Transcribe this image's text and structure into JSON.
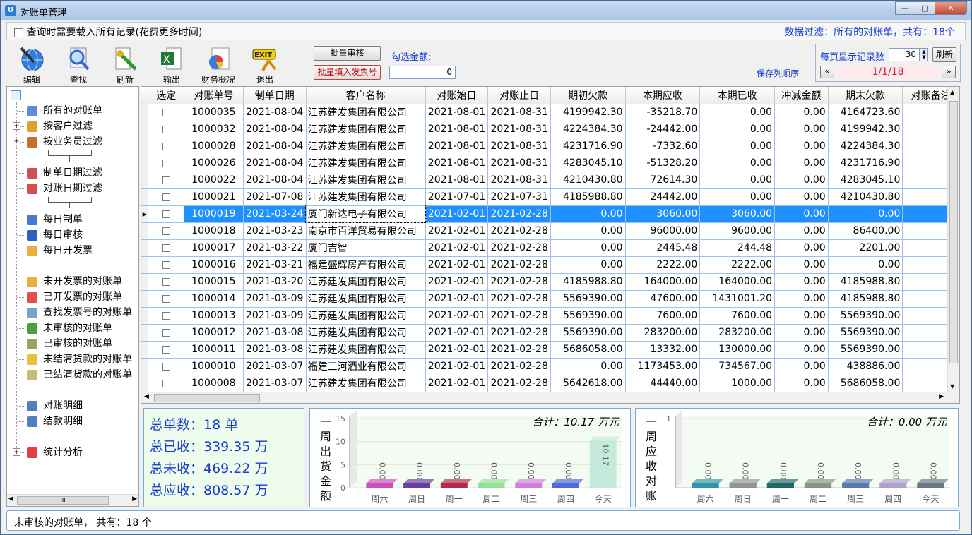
{
  "window": {
    "title": "对账单管理",
    "app_icon": "U"
  },
  "options": {
    "load_all_label": "查询时需要载入所有记录(花费更多时间)",
    "filter_info": "数据过滤：所有的对账单，共有：18个"
  },
  "toolbar": {
    "edit": "编辑",
    "find": "查找",
    "refresh": "刷新",
    "export": "输出",
    "finance": "财务概况",
    "exit": "退出",
    "exit_badge": "EXIT",
    "batch_audit": "批量审核",
    "batch_invoice": "批量填入发票号",
    "checked_amount_label": "勾选金额:",
    "checked_amount": "0",
    "save_order": "保存列顺序",
    "page_size_label": "每页显示记录数",
    "page_size": "30",
    "refresh_btn": "刷新",
    "page_indicator": "1/1/18",
    "prev": "«",
    "next": "»"
  },
  "tree": {
    "items": [
      {
        "label": "所有的对账单"
      },
      {
        "label": "按客户过滤"
      },
      {
        "label": "按业务员过滤"
      },
      {
        "label": "制单日期过滤"
      },
      {
        "label": "对账日期过滤"
      },
      {
        "label": "每日制单"
      },
      {
        "label": "每日审核"
      },
      {
        "label": "每日开发票"
      },
      {
        "label": "未开发票的对账单"
      },
      {
        "label": "已开发票的对账单"
      },
      {
        "label": "查找发票号的对账单"
      },
      {
        "label": "未审核的对账单"
      },
      {
        "label": "已审核的对账单"
      },
      {
        "label": "未结清货款的对账单"
      },
      {
        "label": "已结清货款的对账单"
      },
      {
        "label": "对账明细"
      },
      {
        "label": "结款明细"
      },
      {
        "label": "统计分析"
      }
    ],
    "scroll_mid": "III"
  },
  "grid": {
    "columns": [
      "选定",
      "对账单号",
      "制单日期",
      "客户名称",
      "对账始日",
      "对账止日",
      "期初欠款",
      "本期应收",
      "本期已收",
      "冲减金额",
      "期末欠款",
      "对账备注"
    ],
    "rows": [
      [
        "1000035",
        "2021-08-04",
        "江苏建发集团有限公司",
        "2021-08-01",
        "2021-08-31",
        "4199942.30",
        "-35218.70",
        "0.00",
        "0.00",
        "4164723.60"
      ],
      [
        "1000032",
        "2021-08-04",
        "江苏建发集团有限公司",
        "2021-08-01",
        "2021-08-31",
        "4224384.30",
        "-24442.00",
        "0.00",
        "0.00",
        "4199942.30"
      ],
      [
        "1000028",
        "2021-08-04",
        "江苏建发集团有限公司",
        "2021-08-01",
        "2021-08-31",
        "4231716.90",
        "-7332.60",
        "0.00",
        "0.00",
        "4224384.30"
      ],
      [
        "1000026",
        "2021-08-04",
        "江苏建发集团有限公司",
        "2021-08-01",
        "2021-08-31",
        "4283045.10",
        "-51328.20",
        "0.00",
        "0.00",
        "4231716.90"
      ],
      [
        "1000022",
        "2021-08-04",
        "江苏建发集团有限公司",
        "2021-08-01",
        "2021-08-31",
        "4210430.80",
        "72614.30",
        "0.00",
        "0.00",
        "4283045.10"
      ],
      [
        "1000021",
        "2021-07-08",
        "江苏建发集团有限公司",
        "2021-07-01",
        "2021-07-31",
        "4185988.80",
        "24442.00",
        "0.00",
        "0.00",
        "4210430.80"
      ],
      [
        "1000019",
        "2021-03-24",
        "厦门新达电子有限公司",
        "2021-02-01",
        "2021-02-28",
        "0.00",
        "3060.00",
        "3060.00",
        "0.00",
        "0.00"
      ],
      [
        "1000018",
        "2021-03-23",
        "南京市百洋贸易有限公司",
        "2021-02-01",
        "2021-02-28",
        "0.00",
        "96000.00",
        "9600.00",
        "0.00",
        "86400.00"
      ],
      [
        "1000017",
        "2021-03-22",
        "厦门吉智",
        "2021-02-01",
        "2021-02-28",
        "0.00",
        "2445.48",
        "244.48",
        "0.00",
        "2201.00"
      ],
      [
        "1000016",
        "2021-03-21",
        "福建盛辉房产有限公司",
        "2021-02-01",
        "2021-02-28",
        "0.00",
        "2222.00",
        "2222.00",
        "0.00",
        "0.00"
      ],
      [
        "1000015",
        "2021-03-20",
        "江苏建发集团有限公司",
        "2021-02-01",
        "2021-02-28",
        "4185988.80",
        "164000.00",
        "164000.00",
        "0.00",
        "4185988.80"
      ],
      [
        "1000014",
        "2021-03-09",
        "江苏建发集团有限公司",
        "2021-02-01",
        "2021-02-28",
        "5569390.00",
        "47600.00",
        "1431001.20",
        "0.00",
        "4185988.80"
      ],
      [
        "1000013",
        "2021-03-09",
        "江苏建发集团有限公司",
        "2021-02-01",
        "2021-02-28",
        "5569390.00",
        "7600.00",
        "7600.00",
        "0.00",
        "5569390.00"
      ],
      [
        "1000012",
        "2021-03-08",
        "江苏建发集团有限公司",
        "2021-02-01",
        "2021-02-28",
        "5569390.00",
        "283200.00",
        "283200.00",
        "0.00",
        "5569390.00"
      ],
      [
        "1000011",
        "2021-03-08",
        "江苏建发集团有限公司",
        "2021-02-01",
        "2021-02-28",
        "5686058.00",
        "13332.00",
        "130000.00",
        "0.00",
        "5569390.00"
      ],
      [
        "1000010",
        "2021-03-07",
        "福建三河酒业有限公司",
        "2021-02-01",
        "2021-02-28",
        "0.00",
        "1173453.00",
        "734567.00",
        "0.00",
        "438886.00"
      ],
      [
        "1000008",
        "2021-03-07",
        "江苏建发集团有限公司",
        "2021-02-01",
        "2021-02-28",
        "5642618.00",
        "44440.00",
        "1000.00",
        "0.00",
        "5686058.00"
      ]
    ],
    "selected_row": 6
  },
  "summary": {
    "count": "总单数：18 单",
    "received": "总已收：339.35 万",
    "unreceived": "总未收：469.22 万",
    "receivable": "总应收：808.57 万"
  },
  "chart_data": [
    {
      "type": "bar",
      "title": "一周出货金额",
      "total_label": "合计：10.17 万元",
      "categories": [
        "周六",
        "周日",
        "周一",
        "周二",
        "周三",
        "周四",
        "今天"
      ],
      "values": [
        0,
        0,
        0,
        0,
        0,
        0,
        10.17
      ],
      "value_labels": [
        "0.00",
        "0.00",
        "0.00",
        "0.00",
        "0.00",
        "0.00",
        "10.17"
      ],
      "ylim": [
        0,
        15
      ],
      "yticks": [
        0,
        5,
        10,
        15
      ],
      "colors": [
        "#c63cb8",
        "#5a2a9a",
        "#b0103a",
        "#88e088",
        "#d070d8",
        "#3a5ad8",
        "#bfe8d8"
      ]
    },
    {
      "type": "bar",
      "title": "一周应收对账",
      "total_label": "合计：0.00 万元",
      "categories": [
        "周六",
        "周日",
        "周一",
        "周二",
        "周三",
        "周四",
        "今天"
      ],
      "values": [
        0,
        0,
        0,
        0,
        0,
        0,
        0
      ],
      "value_labels": [
        "0.00",
        "0.00",
        "0.00",
        "0.00",
        "0.00",
        "0.00",
        "0.00"
      ],
      "ylim": [
        0,
        1
      ],
      "yticks": [
        1
      ],
      "colors": [
        "#1a8aa0",
        "#8a8a8a",
        "#0a5a5a",
        "#7a8a7a",
        "#4a6aaa",
        "#a898c8",
        "#5a6a7a"
      ]
    }
  ],
  "status": {
    "text": "未审核的对账单， 共有：18 个"
  }
}
